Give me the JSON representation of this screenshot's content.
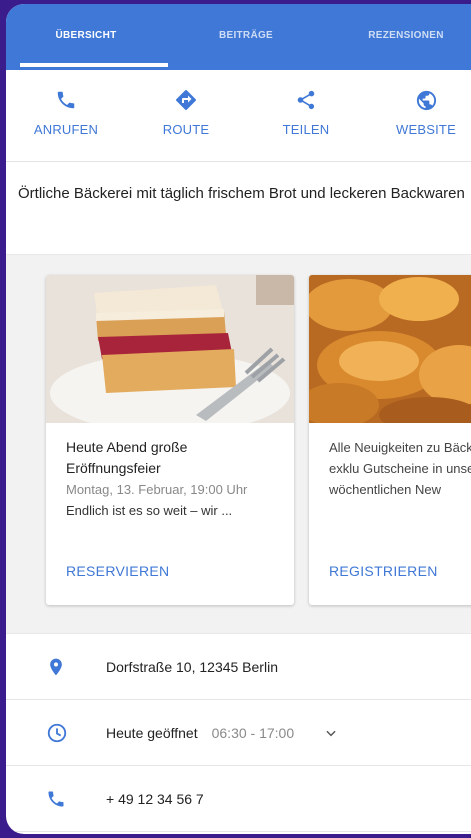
{
  "tabs": [
    {
      "label": "ÜBERSICHT"
    },
    {
      "label": "BEITRÄGE"
    },
    {
      "label": "REZENSIONEN"
    }
  ],
  "actions": [
    {
      "label": "ANRUFEN",
      "icon": "phone-icon"
    },
    {
      "label": "ROUTE",
      "icon": "directions-icon"
    },
    {
      "label": "TEILEN",
      "icon": "share-icon"
    },
    {
      "label": "WEBSITE",
      "icon": "globe-icon"
    }
  ],
  "description": "Örtliche Bäckerei mit täglich frischem Brot und leckeren Backwaren",
  "posts": [
    {
      "title": "Heute Abend große Eröffnungsfeier",
      "meta": "Montag, 13. Februar, 19:00 Uhr",
      "text": "Endlich ist es so weit – wir ...",
      "link": "RESERVIEREN"
    },
    {
      "title": "",
      "meta": "",
      "text": "Alle Neuigkeiten zu Bäckerei und exklu Gutscheine in unse wöchentlichen New",
      "link": "REGISTRIEREN"
    }
  ],
  "info": {
    "address": "Dorfstraße 10, 12345 Berlin",
    "hours_label": "Heute geöffnet",
    "hours_time": "06:30 - 17:00",
    "phone": "+ 49 12 34 56 7"
  },
  "colors": {
    "accent": "#3f78d6",
    "background": "#3a1c8c"
  }
}
